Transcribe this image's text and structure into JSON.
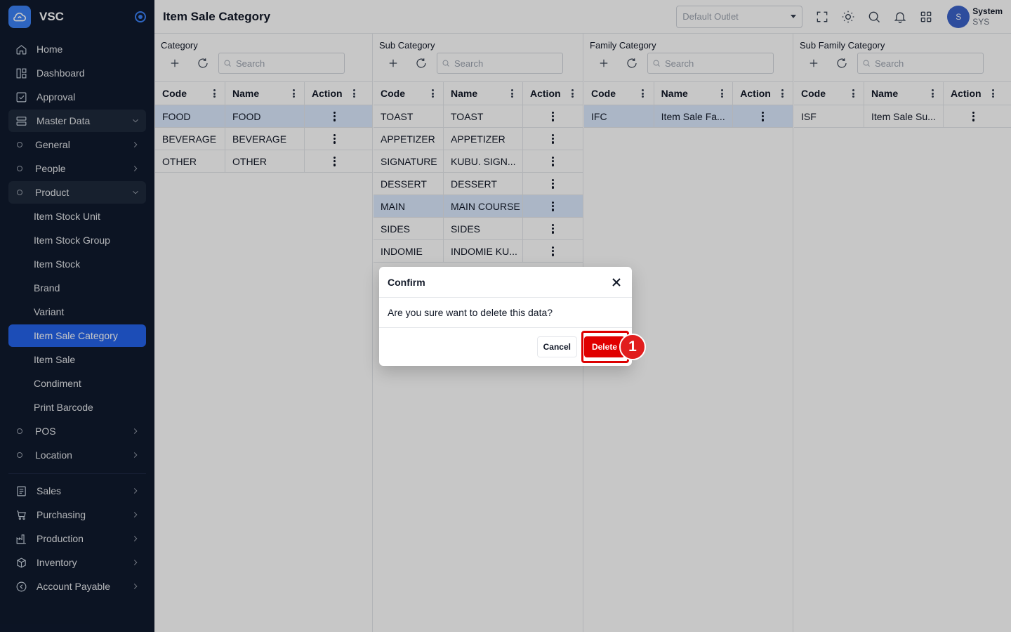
{
  "app": {
    "name": "VSC"
  },
  "sidebar": {
    "items": [
      {
        "label": "Home",
        "icon": "home-icon"
      },
      {
        "label": "Dashboard",
        "icon": "dashboard-icon"
      },
      {
        "label": "Approval",
        "icon": "approval-icon"
      },
      {
        "label": "Master Data",
        "icon": "database-icon"
      },
      {
        "label": "General"
      },
      {
        "label": "People"
      },
      {
        "label": "Product"
      },
      {
        "label": "Item Stock Unit"
      },
      {
        "label": "Item Stock Group"
      },
      {
        "label": "Item Stock"
      },
      {
        "label": "Brand"
      },
      {
        "label": "Variant"
      },
      {
        "label": "Item Sale Category"
      },
      {
        "label": "Item Sale"
      },
      {
        "label": "Condiment"
      },
      {
        "label": "Print Barcode"
      },
      {
        "label": "POS"
      },
      {
        "label": "Location"
      },
      {
        "label": "Sales",
        "icon": "sales-icon"
      },
      {
        "label": "Purchasing",
        "icon": "cart-icon"
      },
      {
        "label": "Production",
        "icon": "factory-icon"
      },
      {
        "label": "Inventory",
        "icon": "box-icon"
      },
      {
        "label": "Account Payable",
        "icon": "account-payable-icon"
      }
    ]
  },
  "header": {
    "title": "Item Sale Category",
    "outlet_placeholder": "Default Outlet",
    "user": {
      "initial": "S",
      "name": "System",
      "code": "SYS"
    }
  },
  "panels": [
    {
      "title": "Category",
      "search_placeholder": "Search",
      "columns": [
        "Code",
        "Name",
        "Action"
      ],
      "rows": [
        {
          "code": "FOOD",
          "name": "FOOD"
        },
        {
          "code": "BEVERAGE",
          "name": "BEVERAGE"
        },
        {
          "code": "OTHER",
          "name": "OTHER"
        }
      ]
    },
    {
      "title": "Sub Category",
      "search_placeholder": "Search",
      "columns": [
        "Code",
        "Name",
        "Action"
      ],
      "rows": [
        {
          "code": "TOAST",
          "name": "TOAST"
        },
        {
          "code": "APPETIZER",
          "name": "APPETIZER"
        },
        {
          "code": "SIGNATURE",
          "name": "KUBU. SIGN..."
        },
        {
          "code": "DESSERT",
          "name": "DESSERT"
        },
        {
          "code": "MAIN",
          "name": "MAIN COURSE"
        },
        {
          "code": "SIDES",
          "name": "SIDES"
        },
        {
          "code": "INDOMIE",
          "name": "INDOMIE KU..."
        }
      ]
    },
    {
      "title": "Family Category",
      "search_placeholder": "Search",
      "columns": [
        "Code",
        "Name",
        "Action"
      ],
      "rows": [
        {
          "code": "IFC",
          "name": "Item Sale Fa..."
        }
      ]
    },
    {
      "title": "Sub Family Category",
      "search_placeholder": "Search",
      "columns": [
        "Code",
        "Name",
        "Action"
      ],
      "rows": [
        {
          "code": "ISF",
          "name": "Item Sale Su..."
        }
      ]
    }
  ],
  "dialog": {
    "title": "Confirm",
    "message": "Are you sure want to delete this data?",
    "cancel_label": "Cancel",
    "delete_label": "Delete"
  },
  "annotation": {
    "step": "1"
  },
  "colors": {
    "accent": "#2563eb",
    "danger": "#e00000",
    "sidebar_bg": "#101a2e"
  }
}
